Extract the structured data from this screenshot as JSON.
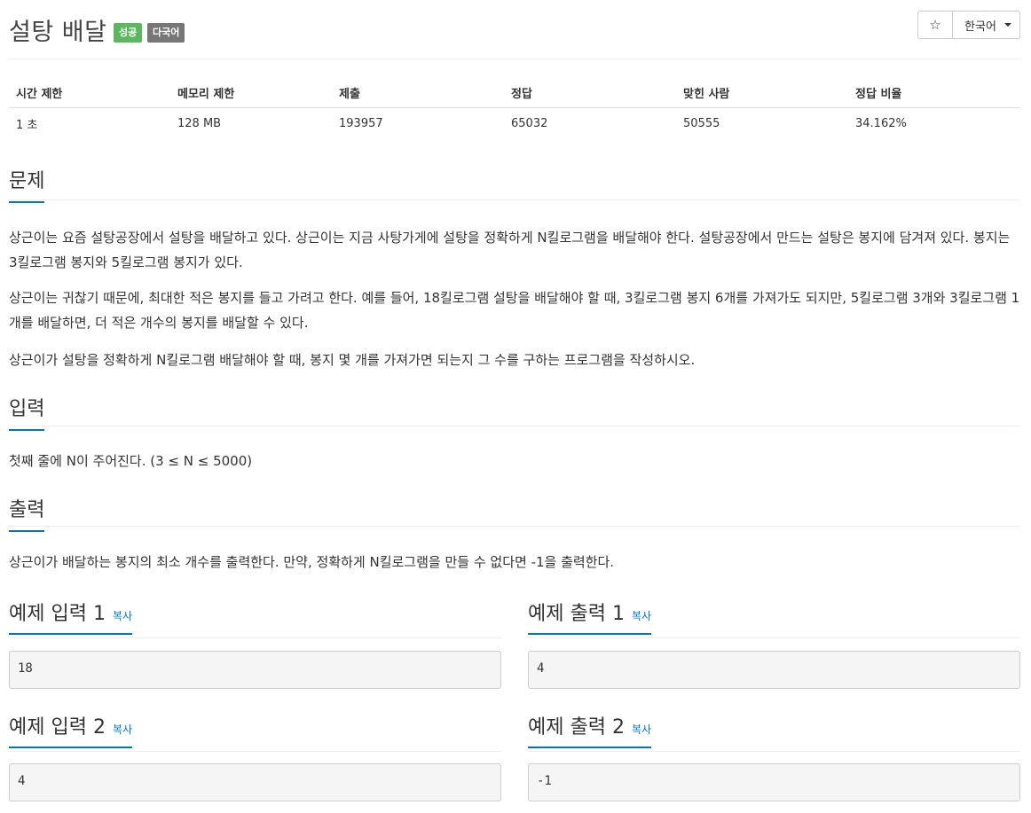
{
  "problem": {
    "title": "설탕 배달",
    "badges": {
      "success": "성공",
      "multilang": "다국어"
    }
  },
  "toolbar": {
    "star_icon": "☆",
    "language": "한국어"
  },
  "info_table": {
    "headers": [
      "시간 제한",
      "메모리 제한",
      "제출",
      "정답",
      "맞힌 사람",
      "정답 비율"
    ],
    "values": [
      "1 초",
      "128 MB",
      "193957",
      "65032",
      "50555",
      "34.162%"
    ]
  },
  "sections": {
    "problem": {
      "heading": "문제",
      "paragraphs": [
        "상근이는 요즘 설탕공장에서 설탕을 배달하고 있다. 상근이는 지금 사탕가게에 설탕을 정확하게 N킬로그램을 배달해야 한다. 설탕공장에서 만드는 설탕은 봉지에 담겨져 있다. 봉지는 3킬로그램 봉지와 5킬로그램 봉지가 있다.",
        "상근이는 귀찮기 때문에, 최대한 적은 봉지를 들고 가려고 한다. 예를 들어, 18킬로그램 설탕을 배달해야 할 때, 3킬로그램 봉지 6개를 가져가도 되지만, 5킬로그램 3개와 3킬로그램 1개를 배달하면, 더 적은 개수의 봉지를 배달할 수 있다.",
        "상근이가 설탕을 정확하게 N킬로그램 배달해야 할 때, 봉지 몇 개를 가져가면 되는지 그 수를 구하는 프로그램을 작성하시오."
      ]
    },
    "input": {
      "heading": "입력",
      "text": "첫째 줄에 N이 주어진다. (3 ≤ N ≤ 5000)"
    },
    "output": {
      "heading": "출력",
      "text": "상근이가 배달하는 봉지의 최소 개수를 출력한다. 만약, 정확하게 N킬로그램을 만들 수 없다면 -1을 출력한다."
    }
  },
  "samples": {
    "copy_label": "복사",
    "input1": {
      "heading": "예제 입력 1",
      "value": "18"
    },
    "output1": {
      "heading": "예제 출력 1",
      "value": "4"
    },
    "input2": {
      "heading": "예제 입력 2",
      "value": "4"
    },
    "output2": {
      "heading": "예제 출력 2",
      "value": "-1"
    }
  },
  "colors": {
    "accent": "#0076c0",
    "success_badge": "#5cb85c",
    "lang_badge": "#777777"
  }
}
